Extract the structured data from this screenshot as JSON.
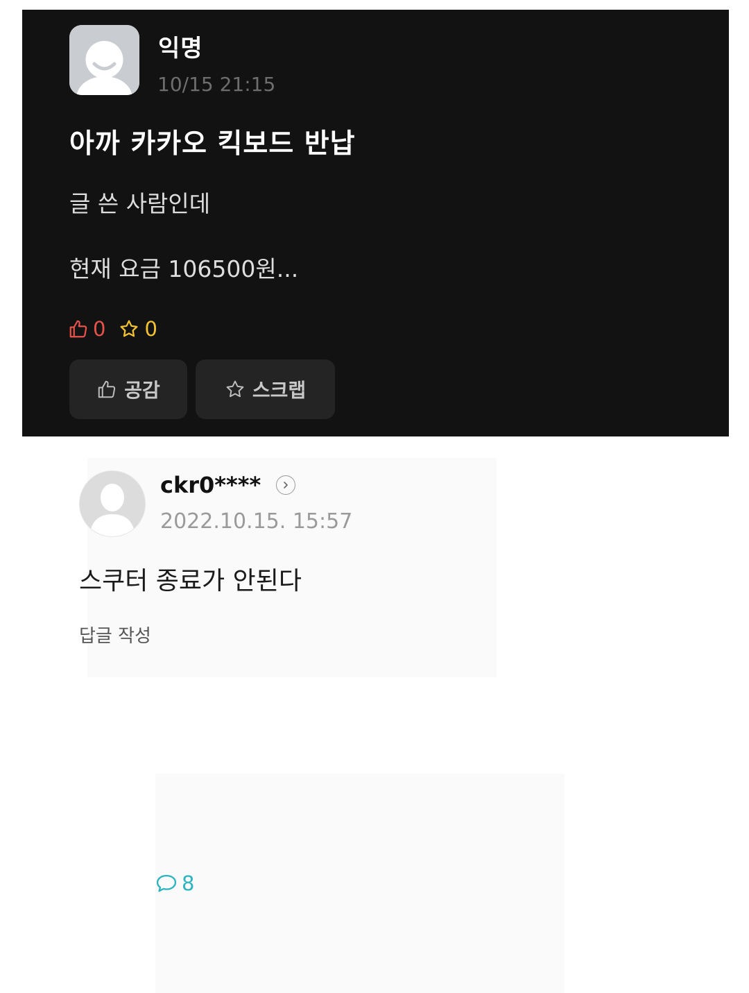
{
  "post": {
    "author": "익명",
    "time": "10/15 21:15",
    "title": "아까 카카오 킥보드 반납",
    "body_lines": [
      "글 쓴 사람인데",
      "현재 요금 106500원..."
    ],
    "stats": {
      "likes": "0",
      "comments": "8",
      "scraps": "0"
    },
    "buttons": {
      "like": "공감",
      "scrap": "스크랩"
    },
    "colors": {
      "like": "#e5534b",
      "comment": "#2db4c0",
      "scrap": "#f2c230"
    }
  },
  "comment": {
    "user": "ckr0****",
    "date": "2022.10.15. 15:57",
    "text": "스쿠터 종료가 안된다",
    "reply_label": "답글 작성"
  },
  "icons": [
    "default-avatar-icon",
    "thumbs-up-icon",
    "speech-bubble-icon",
    "star-icon",
    "chevron-right-icon"
  ]
}
